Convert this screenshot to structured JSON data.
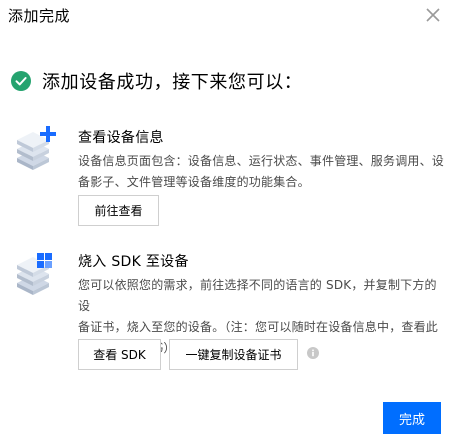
{
  "dialog": {
    "title": "添加完成",
    "close_icon": "close-icon"
  },
  "success": {
    "icon": "check-circle-icon",
    "message": "添加设备成功，接下来您可以：",
    "color": "#25a36f"
  },
  "steps": [
    {
      "icon": "device-stack-add-icon",
      "title": "查看设备信息",
      "description_lines": [
        "设备信息页面包含：设备信息、运行状态、事件管理、服务调用、设",
        "备影子、文件管理等设备维度的功能集合。"
      ],
      "buttons": [
        "前往查看"
      ]
    },
    {
      "icon": "device-stack-sdk-icon",
      "title": "烧入 SDK 至设备",
      "description_lines": [
        "您可以依照您的需求，前往选择不同的语言的 SDK，并复制下方的设",
        "备证书，烧入至您的设备。（注：您可以随时在设备信息中，查看此",
        "设备的设备证书）"
      ],
      "buttons": [
        "查看 SDK",
        "一键复制设备证书"
      ],
      "info_icon": "info-icon"
    }
  ],
  "footer": {
    "done_label": "完成"
  },
  "colors": {
    "primary": "#006eff",
    "success": "#25a36f",
    "icon_blue": "#1a6cff"
  }
}
